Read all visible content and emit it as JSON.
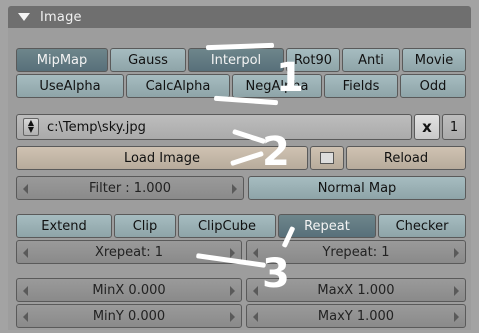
{
  "panel": {
    "title": "Image"
  },
  "row1": [
    "MipMap",
    "Gauss",
    "Interpol",
    "Rot90",
    "Anti",
    "Movie"
  ],
  "row2": [
    "UseAlpha",
    "CalcAlpha",
    "NegAlpha",
    "Fields",
    "Odd"
  ],
  "file": {
    "path": "c:\\Temp\\sky.jpg",
    "close_label": "x",
    "users": "1"
  },
  "load_label": "Load Image",
  "reload_label": "Reload",
  "filter": "Filter : 1.000",
  "normal_map": "Normal Map",
  "tabs": [
    "Extend",
    "Clip",
    "ClipCube",
    "Repeat",
    "Checker"
  ],
  "active_tab": "Repeat",
  "xrepeat": "Xrepeat: 1",
  "yrepeat": "Yrepeat: 1",
  "minx": "MinX 0.000",
  "maxx": "MaxX 1.000",
  "miny": "MinY 0.000",
  "maxy": "MaxY 1.000",
  "annotations": [
    "1",
    "2",
    "3"
  ],
  "colors": {
    "header": "#6f6f6f",
    "toggle": "#9fb4b8",
    "toggle_on": "#627a80",
    "push": "#c4b8a8",
    "annotation": "#ffffff"
  }
}
